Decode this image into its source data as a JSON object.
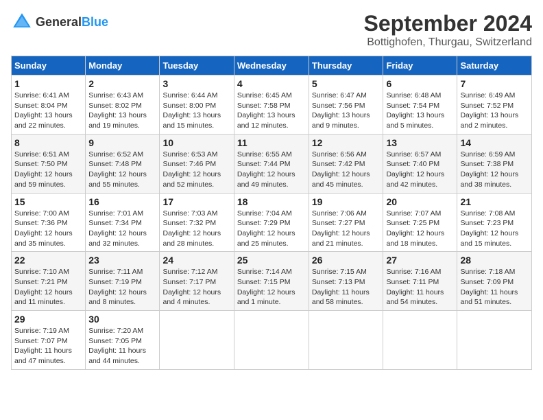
{
  "header": {
    "logo_general": "General",
    "logo_blue": "Blue",
    "month": "September 2024",
    "location": "Bottighofen, Thurgau, Switzerland"
  },
  "weekdays": [
    "Sunday",
    "Monday",
    "Tuesday",
    "Wednesday",
    "Thursday",
    "Friday",
    "Saturday"
  ],
  "weeks": [
    [
      {
        "day": "1",
        "sunrise": "6:41 AM",
        "sunset": "8:04 PM",
        "daylight": "13 hours and 22 minutes."
      },
      {
        "day": "2",
        "sunrise": "6:43 AM",
        "sunset": "8:02 PM",
        "daylight": "13 hours and 19 minutes."
      },
      {
        "day": "3",
        "sunrise": "6:44 AM",
        "sunset": "8:00 PM",
        "daylight": "13 hours and 15 minutes."
      },
      {
        "day": "4",
        "sunrise": "6:45 AM",
        "sunset": "7:58 PM",
        "daylight": "13 hours and 12 minutes."
      },
      {
        "day": "5",
        "sunrise": "6:47 AM",
        "sunset": "7:56 PM",
        "daylight": "13 hours and 9 minutes."
      },
      {
        "day": "6",
        "sunrise": "6:48 AM",
        "sunset": "7:54 PM",
        "daylight": "13 hours and 5 minutes."
      },
      {
        "day": "7",
        "sunrise": "6:49 AM",
        "sunset": "7:52 PM",
        "daylight": "13 hours and 2 minutes."
      }
    ],
    [
      {
        "day": "8",
        "sunrise": "6:51 AM",
        "sunset": "7:50 PM",
        "daylight": "12 hours and 59 minutes."
      },
      {
        "day": "9",
        "sunrise": "6:52 AM",
        "sunset": "7:48 PM",
        "daylight": "12 hours and 55 minutes."
      },
      {
        "day": "10",
        "sunrise": "6:53 AM",
        "sunset": "7:46 PM",
        "daylight": "12 hours and 52 minutes."
      },
      {
        "day": "11",
        "sunrise": "6:55 AM",
        "sunset": "7:44 PM",
        "daylight": "12 hours and 49 minutes."
      },
      {
        "day": "12",
        "sunrise": "6:56 AM",
        "sunset": "7:42 PM",
        "daylight": "12 hours and 45 minutes."
      },
      {
        "day": "13",
        "sunrise": "6:57 AM",
        "sunset": "7:40 PM",
        "daylight": "12 hours and 42 minutes."
      },
      {
        "day": "14",
        "sunrise": "6:59 AM",
        "sunset": "7:38 PM",
        "daylight": "12 hours and 38 minutes."
      }
    ],
    [
      {
        "day": "15",
        "sunrise": "7:00 AM",
        "sunset": "7:36 PM",
        "daylight": "12 hours and 35 minutes."
      },
      {
        "day": "16",
        "sunrise": "7:01 AM",
        "sunset": "7:34 PM",
        "daylight": "12 hours and 32 minutes."
      },
      {
        "day": "17",
        "sunrise": "7:03 AM",
        "sunset": "7:32 PM",
        "daylight": "12 hours and 28 minutes."
      },
      {
        "day": "18",
        "sunrise": "7:04 AM",
        "sunset": "7:29 PM",
        "daylight": "12 hours and 25 minutes."
      },
      {
        "day": "19",
        "sunrise": "7:06 AM",
        "sunset": "7:27 PM",
        "daylight": "12 hours and 21 minutes."
      },
      {
        "day": "20",
        "sunrise": "7:07 AM",
        "sunset": "7:25 PM",
        "daylight": "12 hours and 18 minutes."
      },
      {
        "day": "21",
        "sunrise": "7:08 AM",
        "sunset": "7:23 PM",
        "daylight": "12 hours and 15 minutes."
      }
    ],
    [
      {
        "day": "22",
        "sunrise": "7:10 AM",
        "sunset": "7:21 PM",
        "daylight": "12 hours and 11 minutes."
      },
      {
        "day": "23",
        "sunrise": "7:11 AM",
        "sunset": "7:19 PM",
        "daylight": "12 hours and 8 minutes."
      },
      {
        "day": "24",
        "sunrise": "7:12 AM",
        "sunset": "7:17 PM",
        "daylight": "12 hours and 4 minutes."
      },
      {
        "day": "25",
        "sunrise": "7:14 AM",
        "sunset": "7:15 PM",
        "daylight": "12 hours and 1 minute."
      },
      {
        "day": "26",
        "sunrise": "7:15 AM",
        "sunset": "7:13 PM",
        "daylight": "11 hours and 58 minutes."
      },
      {
        "day": "27",
        "sunrise": "7:16 AM",
        "sunset": "7:11 PM",
        "daylight": "11 hours and 54 minutes."
      },
      {
        "day": "28",
        "sunrise": "7:18 AM",
        "sunset": "7:09 PM",
        "daylight": "11 hours and 51 minutes."
      }
    ],
    [
      {
        "day": "29",
        "sunrise": "7:19 AM",
        "sunset": "7:07 PM",
        "daylight": "11 hours and 47 minutes."
      },
      {
        "day": "30",
        "sunrise": "7:20 AM",
        "sunset": "7:05 PM",
        "daylight": "11 hours and 44 minutes."
      },
      null,
      null,
      null,
      null,
      null
    ]
  ]
}
